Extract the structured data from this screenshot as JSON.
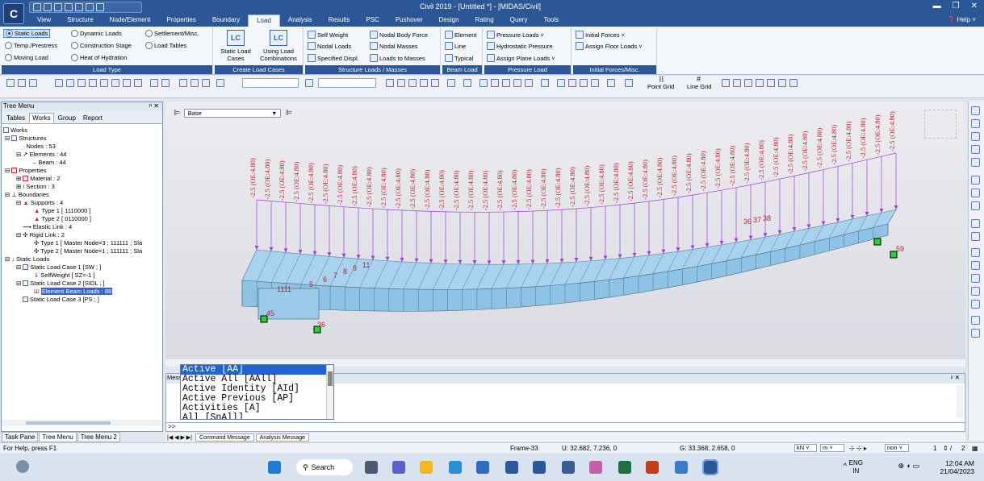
{
  "app": {
    "logo_text": "C",
    "window_title": "Civil 2019 - [Untitled *] - [MIDAS/Civil]",
    "help_label": "Help"
  },
  "menu_tabs": [
    "View",
    "Structure",
    "Node/Element",
    "Properties",
    "Boundary",
    "Load",
    "Analysis",
    "Results",
    "PSC",
    "Pushover",
    "Design",
    "Rating",
    "Query",
    "Tools"
  ],
  "active_menu_tab": "Load",
  "ribbon": {
    "load_type": {
      "label": "Load Type",
      "options": [
        "Static Loads",
        "Dynamic Loads",
        "Settlement/Misc.",
        "Temp./Prestress",
        "Construction Stage",
        "Load Tables",
        "Moving Load",
        "Heat of Hydration"
      ],
      "selected": "Static Loads"
    },
    "create_load_cases": {
      "label": "Create Load Cases",
      "static_load_cases": "Static Load Cases",
      "using_load_combinations": "Using Load Combinations"
    },
    "structure_loads": {
      "label": "Structure Loads / Masses",
      "items": [
        "Self Weight",
        "Nodal Body Force",
        "Nodal Loads",
        "Nodal Masses",
        "Specified Displ.",
        "Loads to Masses"
      ]
    },
    "beam_load": {
      "label": "Beam Load",
      "items": [
        "Element",
        "Line",
        "Typical"
      ]
    },
    "pressure_load": {
      "label": "Pressure Load",
      "items": [
        "Pressure Loads",
        "Hydrostatic Pressure",
        "Assign Plane Loads"
      ]
    },
    "initial_forces": {
      "label": "Initial Forces/Misc.",
      "items": [
        "Initial Forces",
        "Assign Floor Loads"
      ]
    }
  },
  "toolbar": {
    "point_grid": "Point Grid",
    "line_grid": "Line Grid"
  },
  "tree": {
    "title": "Tree Menu",
    "tabs": [
      "Tables",
      "Works",
      "Group",
      "Report"
    ],
    "active_tab": "Works",
    "nodes": [
      "Works",
      "Structures",
      "Nodes : 53",
      "Elements : 44",
      "Beam : 44",
      "Properties",
      "Material : 2",
      "Section : 3",
      "Boundaries",
      "Supports : 4",
      "Type 1 [ 1110000 ]",
      "Type 2 [ 0110000 ]",
      "Elastic Link : 4",
      "Rigid Link : 2",
      "Type 1 [ Master Node=3 ; 111111 ; Sla",
      "Type 2 [ Master Node=1 ; 111111 ; Sla",
      "Static Loads",
      "Static Load Case 1 [SW ; ]",
      "SelfWeight [ SZ=-1 ]",
      "Static Load Case 2 [SIDL ; ]",
      "Element Beam Loads : 88",
      "Static Load Case 3 [PS ; ]"
    ],
    "selected_node": "Element Beam Loads : 88",
    "bottom_tabs": [
      "Task Pane",
      "Tree Menu",
      "Tree Menu 2"
    ],
    "active_bottom_tab": "Tree Menu"
  },
  "viewport": {
    "view_combo": "Base",
    "load_label": "-2.5 (OE:4.80)",
    "node_labels": [
      "59",
      "45",
      "36",
      "1111",
      "5",
      "6",
      "7",
      "8",
      "9",
      "11",
      "38",
      "37",
      "36"
    ]
  },
  "command": {
    "panel_title": "Message",
    "dropdown_options": [
      "Active [AA]",
      "Active All [AAll]",
      "Active Identity [AId]",
      "Active Previous [AP]",
      "Activities [A]",
      "All [SnAll]"
    ],
    "selected_option": "Active [AA]",
    "prompt": ">>",
    "tabs": [
      "Command Message",
      "Analysis Message"
    ]
  },
  "status": {
    "help_text": "For Help, press F1",
    "frame": "Frame-33",
    "u_coords": "U: 32.682, 7.236, 0",
    "g_coords": "G: 33.368, 2.658, 0",
    "unit_force": "kN",
    "unit_length": "m",
    "filter": "non",
    "page": "1",
    "page_total": "2"
  },
  "taskbar": {
    "search": "Search",
    "lang1": "ENG",
    "lang2": "IN",
    "time": "12:04 AM",
    "date": "21/04/2023"
  },
  "colors": {
    "title_bar": "#2b5797",
    "deck": "#a8d2ee",
    "load_arrow": "#a040d8",
    "load_text": "#b3262e",
    "support": "#2ad130"
  }
}
